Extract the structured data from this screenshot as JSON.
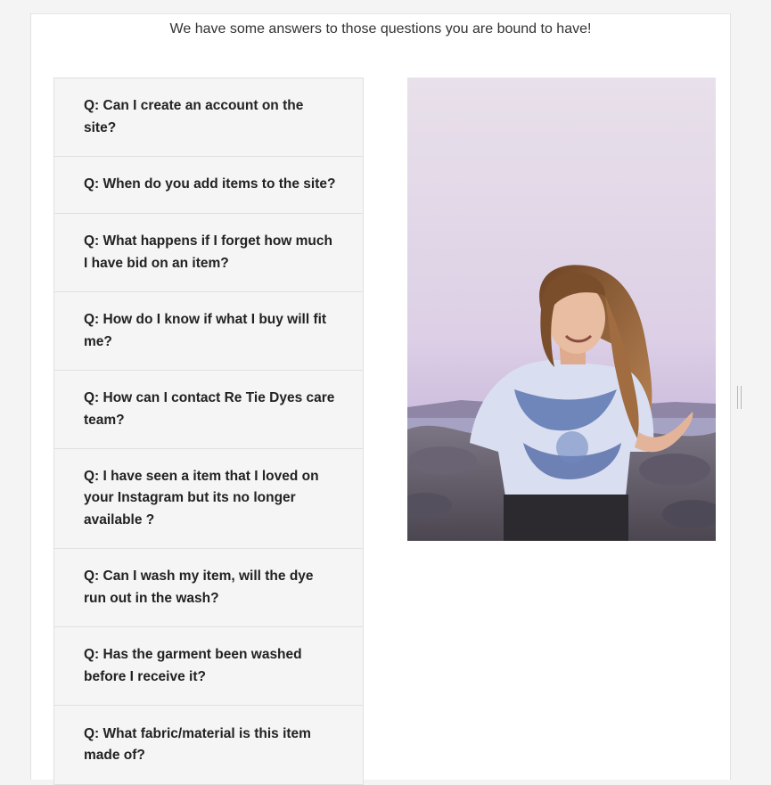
{
  "intro_text": "We have some answers to those questions you are bound to have!",
  "faq": [
    {
      "question": "Q: Can I create an account on the site?"
    },
    {
      "question": "Q: When do you add items to the site?"
    },
    {
      "question": "Q: What happens if I forget how much I have bid on an item?"
    },
    {
      "question": "Q: How do I know if what I buy will fit me?"
    },
    {
      "question": "Q: How can I contact Re Tie Dyes care team?"
    },
    {
      "question": "Q: I have seen a item that I loved on your Instagram but its no longer available ?"
    },
    {
      "question": "Q: Can I wash my item, will the dye run out in the wash?"
    },
    {
      "question": "Q: Has the garment been washed before I receive it?"
    },
    {
      "question": "Q: What fabric/material is this item made of?"
    }
  ],
  "colors": {
    "page_background": "#f4f4f4",
    "card_background": "#ffffff",
    "faq_background": "#f5f5f5",
    "faq_border": "#e0e0e0",
    "text": "#222222"
  }
}
